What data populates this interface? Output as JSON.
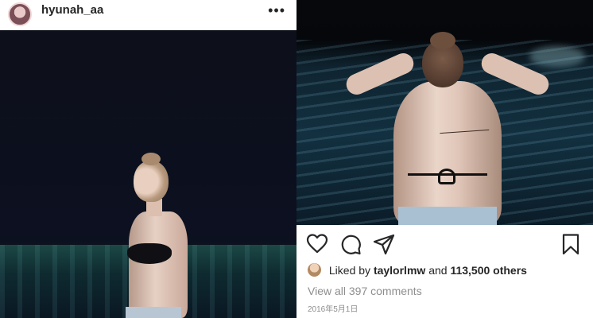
{
  "left_post": {
    "username": "hyunah_aa",
    "more_label": "•••"
  },
  "right_post": {
    "likes": {
      "prefix": "Liked by",
      "user": "taylorlmw",
      "conjunction": "and",
      "count": "113,500 others"
    },
    "comments_link": "View all 397 comments",
    "date": "2016年5月1日"
  },
  "icons": [
    "heart-icon",
    "comment-icon",
    "share-icon",
    "bookmark-icon",
    "more-options-icon"
  ],
  "colors": {
    "text": "#262626",
    "muted": "#8e8e8e",
    "background": "#ffffff"
  }
}
